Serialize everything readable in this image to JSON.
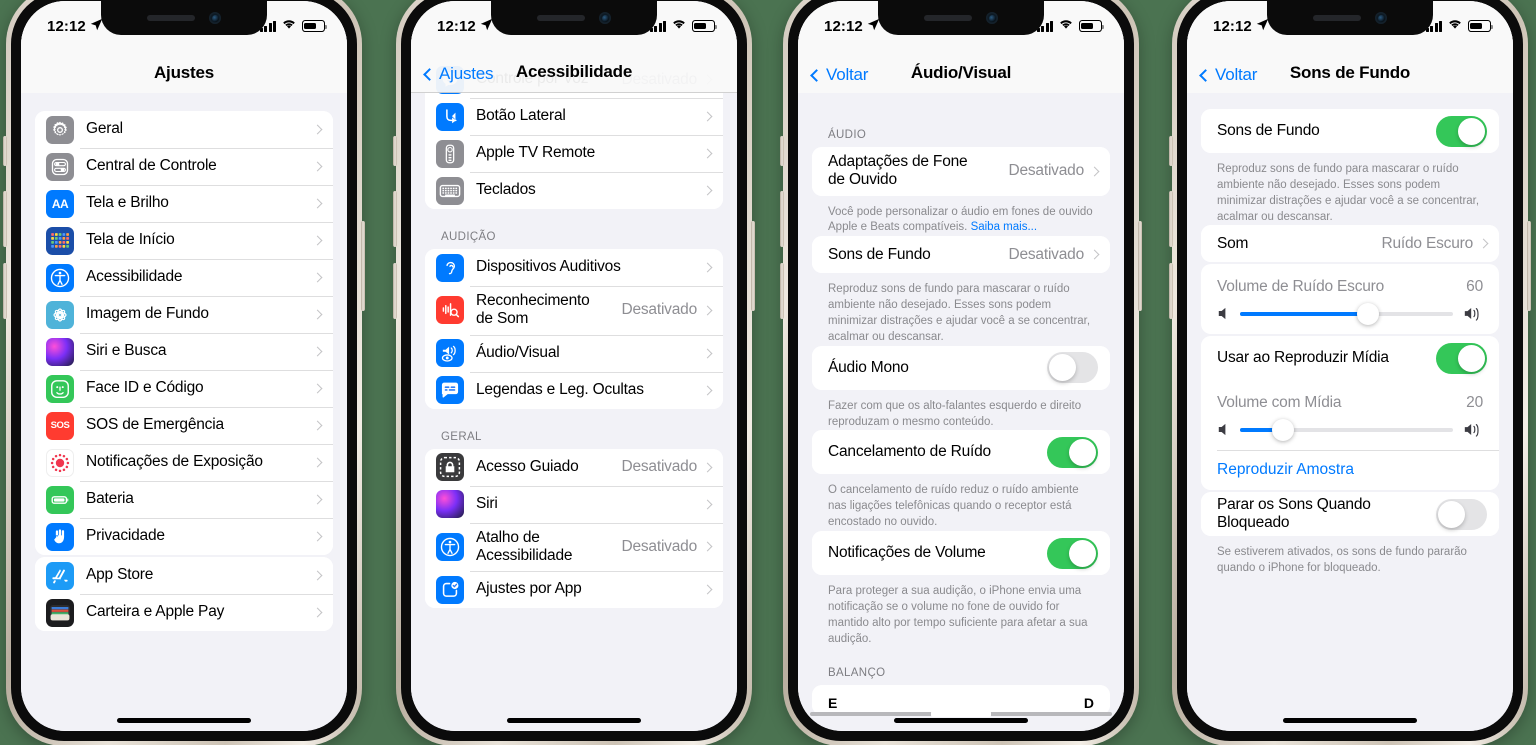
{
  "statusbar": {
    "time": "12:12"
  },
  "phones": [
    {
      "id": "phone-ajustes",
      "nav": {
        "title": "Ajustes",
        "back": null
      },
      "groups": [
        {
          "rows": [
            {
              "label": "Geral",
              "icon": "gear-icon",
              "value": "",
              "accessory": "chevron"
            },
            {
              "label": "Central de Controle",
              "icon": "control-center-icon",
              "value": "",
              "accessory": "chevron"
            },
            {
              "label": "Tela e Brilho",
              "icon": "display-icon",
              "value": "",
              "accessory": "chevron"
            },
            {
              "label": "Tela de Início",
              "icon": "home-screen-icon",
              "value": "",
              "accessory": "chevron"
            },
            {
              "label": "Acessibilidade",
              "icon": "accessibility-icon",
              "value": "",
              "accessory": "chevron"
            },
            {
              "label": "Imagem de Fundo",
              "icon": "wallpaper-icon",
              "value": "",
              "accessory": "chevron"
            },
            {
              "label": "Siri e Busca",
              "icon": "siri-icon",
              "value": "",
              "accessory": "chevron"
            },
            {
              "label": "Face ID e Código",
              "icon": "faceid-icon",
              "value": "",
              "accessory": "chevron"
            },
            {
              "label": "SOS de Emergência",
              "icon": "sos-icon",
              "value": "",
              "accessory": "chevron"
            },
            {
              "label": "Notificações de Exposição",
              "icon": "exposure-icon",
              "value": "",
              "accessory": "chevron"
            },
            {
              "label": "Bateria",
              "icon": "battery-icon",
              "value": "",
              "accessory": "chevron"
            },
            {
              "label": "Privacidade",
              "icon": "privacy-hand-icon",
              "value": "",
              "accessory": "chevron"
            }
          ]
        },
        {
          "rows": [
            {
              "label": "App Store",
              "icon": "appstore-icon",
              "value": "",
              "accessory": "chevron"
            },
            {
              "label": "Carteira e Apple Pay",
              "icon": "wallet-icon",
              "value": "",
              "accessory": "chevron"
            }
          ]
        }
      ]
    },
    {
      "id": "phone-acessibilidade",
      "nav": {
        "title": "Acessibilidade",
        "back": "Ajustes"
      },
      "groups": [
        {
          "rows": [
            {
              "label": "Controle por Voz",
              "icon": "voice-control-icon",
              "value": "Desativado",
              "accessory": "chevron"
            },
            {
              "label": "Botão Lateral",
              "icon": "side-button-icon",
              "value": "",
              "accessory": "chevron"
            },
            {
              "label": "Apple TV Remote",
              "icon": "appletv-remote-icon",
              "value": "",
              "accessory": "chevron"
            },
            {
              "label": "Teclados",
              "icon": "keyboard-icon",
              "value": "",
              "accessory": "chevron"
            }
          ]
        },
        {
          "header": "AUDIÇÃO",
          "rows": [
            {
              "label": "Dispositivos Auditivos",
              "icon": "hearing-devices-icon",
              "value": "",
              "accessory": "chevron"
            },
            {
              "label": "Reconhecimento\nde Som",
              "icon": "sound-recognition-icon",
              "value": "Desativado",
              "accessory": "chevron"
            },
            {
              "label": "Áudio/Visual",
              "icon": "audio-visual-icon",
              "value": "",
              "accessory": "chevron"
            },
            {
              "label": "Legendas e Leg. Ocultas",
              "icon": "captions-icon",
              "value": "",
              "accessory": "chevron"
            }
          ]
        },
        {
          "header": "GERAL",
          "rows": [
            {
              "label": "Acesso Guiado",
              "icon": "guided-access-icon",
              "value": "Desativado",
              "accessory": "chevron"
            },
            {
              "label": "Siri",
              "icon": "siri-icon",
              "value": "",
              "accessory": "chevron"
            },
            {
              "label": "Atalho de\nAcessibilidade",
              "icon": "accessibility-icon",
              "value": "Desativado",
              "accessory": "chevron"
            },
            {
              "label": "Ajustes por App",
              "icon": "per-app-settings-icon",
              "value": "",
              "accessory": "chevron"
            }
          ]
        }
      ]
    },
    {
      "id": "phone-audio-visual",
      "nav": {
        "title": "Áudio/Visual",
        "back": "Voltar"
      },
      "groups": [
        {
          "header": "ÁUDIO",
          "rows": [
            {
              "label": "Adaptações de Fone\nde Ouvido",
              "value": "Desativado",
              "accessory": "chevron"
            }
          ],
          "footer": "Você pode personalizar o áudio em fones de ouvido Apple e Beats compatíveis. ",
          "footer_link": "Saiba mais..."
        },
        {
          "rows": [
            {
              "label": "Sons de Fundo",
              "value": "Desativado",
              "accessory": "chevron"
            }
          ],
          "footer": "Reproduz sons de fundo para mascarar o ruído ambiente não desejado. Esses sons podem minimizar distrações e ajudar você a se concentrar, acalmar ou descansar."
        },
        {
          "rows": [
            {
              "label": "Áudio Mono",
              "accessory": "toggle",
              "toggle": "off"
            }
          ],
          "footer": "Fazer com que os alto-falantes esquerdo e direito reproduzam o mesmo conteúdo."
        },
        {
          "rows": [
            {
              "label": "Cancelamento de Ruído",
              "accessory": "toggle",
              "toggle": "on"
            }
          ],
          "footer": "O cancelamento de ruído reduz o ruído ambiente nas ligações telefônicas quando o receptor está encostado no ouvido."
        },
        {
          "rows": [
            {
              "label": "Notificações de Volume",
              "accessory": "toggle",
              "toggle": "on"
            }
          ],
          "footer": "Para proteger a sua audição, o iPhone envia uma notificação se o volume no fone de ouvido for mantido alto por tempo suficiente para afetar a sua audição."
        },
        {
          "header": "BALANÇO",
          "balance": {
            "left": "E",
            "right": "D"
          }
        }
      ]
    },
    {
      "id": "phone-sons-de-fundo",
      "nav": {
        "title": "Sons de Fundo",
        "back": "Voltar"
      },
      "groups": [
        {
          "rows": [
            {
              "label": "Sons de Fundo",
              "accessory": "toggle",
              "toggle": "on"
            }
          ],
          "footer": "Reproduz sons de fundo para mascarar o ruído ambiente não desejado. Esses sons podem minimizar distrações e ajudar você a se concentrar, acalmar ou descansar."
        },
        {
          "rows": [
            {
              "label": "Som",
              "value": "Ruído Escuro",
              "accessory": "chevron"
            }
          ]
        },
        {
          "slider": {
            "label": "Volume de Ruído Escuro",
            "value": "60",
            "percent": 60
          }
        },
        {
          "rows": [
            {
              "label": "Usar ao Reproduzir Mídia",
              "accessory": "toggle",
              "toggle": "on"
            }
          ],
          "slider": {
            "label": "Volume com Mídia",
            "value": "20",
            "percent": 20
          },
          "link": "Reproduzir Amostra"
        },
        {
          "rows": [
            {
              "label": "Parar os Sons Quando Bloqueado",
              "accessory": "toggle",
              "toggle": "off"
            }
          ],
          "footer": "Se estiverem ativados, os sons de fundo pararão quando o iPhone for bloqueado."
        }
      ]
    }
  ],
  "colors": {
    "accent_blue": "#007aff",
    "toggle_green": "#34c759",
    "page_background": "#f2f2f7",
    "canvas_green": "#4b7351",
    "secondary_text": "#8e8e93"
  }
}
